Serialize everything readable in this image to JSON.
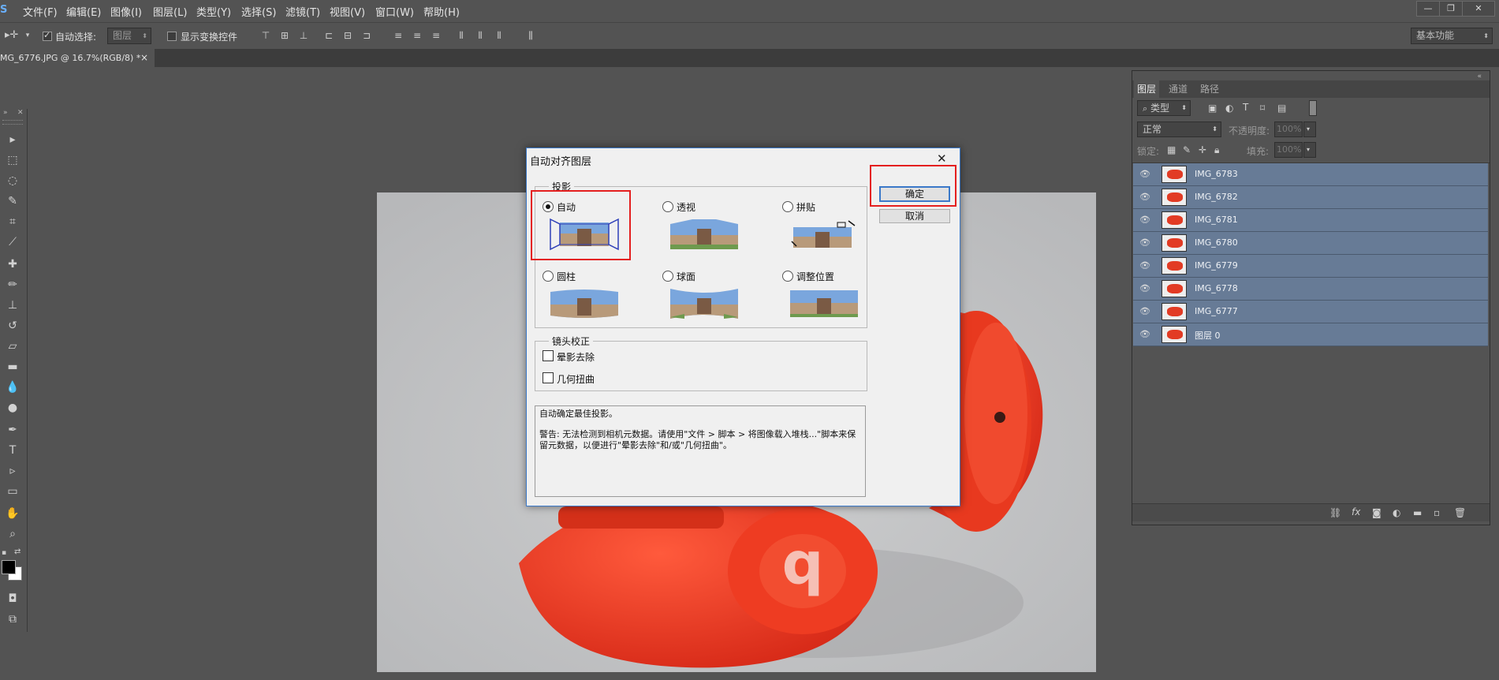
{
  "app": {
    "logo": "S"
  },
  "menu": [
    "文件(F)",
    "编辑(E)",
    "图像(I)",
    "图层(L)",
    "类型(Y)",
    "选择(S)",
    "滤镜(T)",
    "视图(V)",
    "窗口(W)",
    "帮助(H)"
  ],
  "window_controls": {
    "minimize": "—",
    "restore": "❐",
    "close": "✕"
  },
  "options_bar": {
    "auto_select_label": "自动选择:",
    "auto_select_target": "图层",
    "show_transform_label": "显示变换控件",
    "workspace": "基本功能"
  },
  "document_tab": {
    "title": "MG_6776.JPG @ 16.7%(RGB/8) *",
    "close": "×"
  },
  "dialog": {
    "title": "自动对齐图层",
    "close": "✕",
    "projection_legend": "投影",
    "options": [
      {
        "id": "auto",
        "label": "自动",
        "selected": true
      },
      {
        "id": "perspective",
        "label": "透视",
        "selected": false
      },
      {
        "id": "collage",
        "label": "拼贴",
        "selected": false
      },
      {
        "id": "cylindrical",
        "label": "圆柱",
        "selected": false
      },
      {
        "id": "spherical",
        "label": "球面",
        "selected": false
      },
      {
        "id": "reposition",
        "label": "调整位置",
        "selected": false
      }
    ],
    "lens_legend": "镜头校正",
    "vignette_label": "晕影去除",
    "distortion_label": "几何扭曲",
    "info_line1": "自动确定最佳投影。",
    "info_warning": "警告: 无法检测到相机元数据。请使用\"文件 > 脚本 > 将图像载入堆栈...\"脚本来保留元数据，以便进行\"晕影去除\"和/或\"几何扭曲\"。",
    "ok": "确定",
    "cancel": "取消"
  },
  "layers_panel": {
    "tabs": [
      "图层",
      "通道",
      "路径"
    ],
    "filter_kind": "类型",
    "blend_mode": "正常",
    "opacity_label": "不透明度:",
    "opacity_value": "100%",
    "lock_label": "锁定:",
    "fill_label": "填充:",
    "fill_value": "100%",
    "layers": [
      "IMG_6783",
      "IMG_6782",
      "IMG_6781",
      "IMG_6780",
      "IMG_6779",
      "IMG_6778",
      "IMG_6777",
      "图层 0"
    ],
    "footer_fx": "fx"
  },
  "colors": {
    "accent_blue": "#3b79c9",
    "highlight_red": "#e41f1f",
    "layer_selected": "#677b96",
    "headphone_red": "#ef3b26"
  }
}
